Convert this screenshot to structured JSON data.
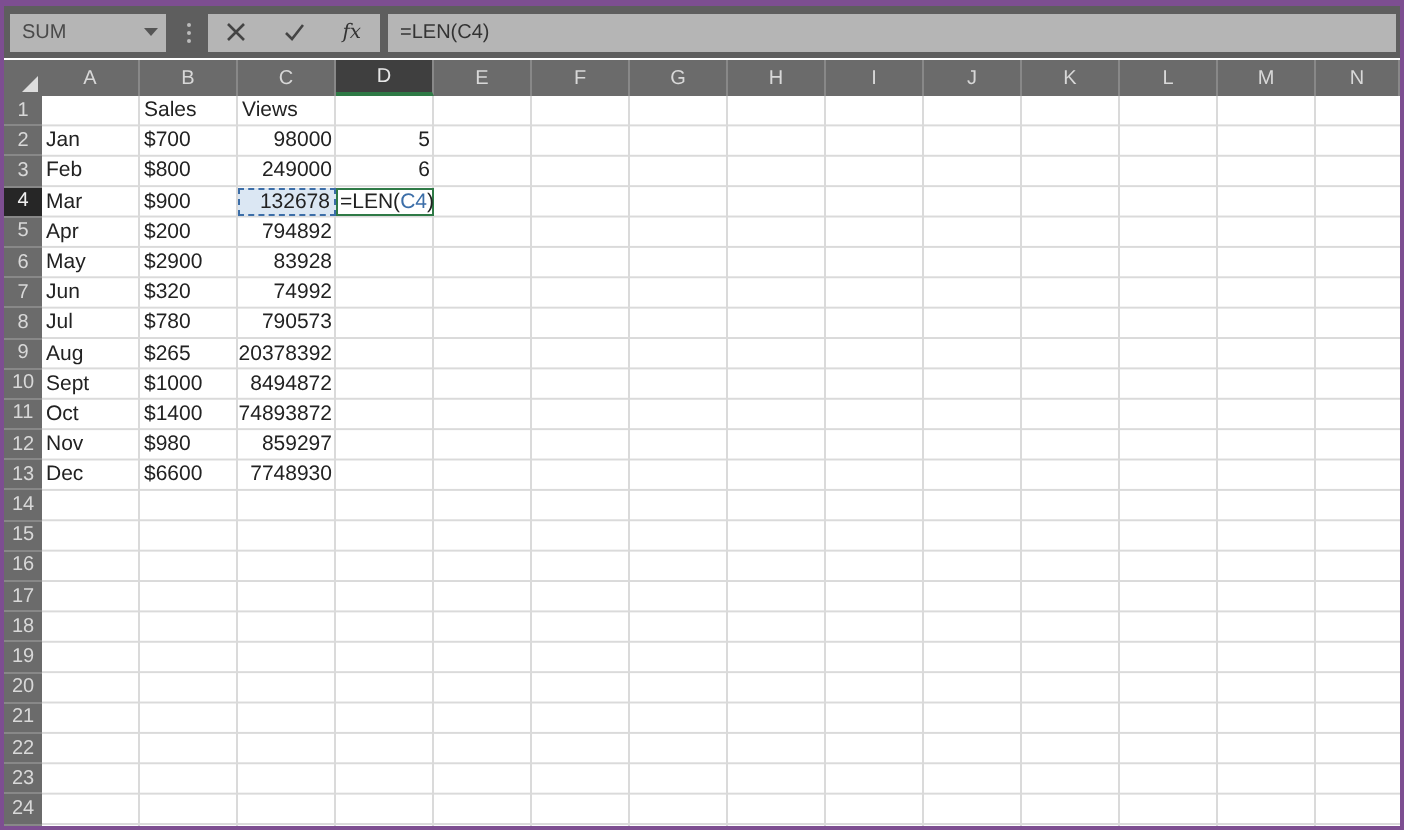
{
  "name_box": {
    "value": "SUM"
  },
  "formula_bar": {
    "buttons": [
      "fx"
    ],
    "formula": "=LEN(C4)"
  },
  "columns": [
    {
      "label": "A",
      "selected": false
    },
    {
      "label": "B",
      "selected": false
    },
    {
      "label": "C",
      "selected": false
    },
    {
      "label": "D",
      "selected": true
    },
    {
      "label": "E",
      "selected": false
    },
    {
      "label": "F",
      "selected": false
    },
    {
      "label": "G",
      "selected": false
    },
    {
      "label": "H",
      "selected": false
    },
    {
      "label": "I",
      "selected": false
    },
    {
      "label": "J",
      "selected": false
    },
    {
      "label": "K",
      "selected": false
    },
    {
      "label": "L",
      "selected": false
    },
    {
      "label": "M",
      "selected": false
    },
    {
      "label": "N",
      "selected": false
    }
  ],
  "rows": [
    {
      "label": "1",
      "selected": false,
      "cells": [
        null,
        {
          "text": "Sales",
          "kind": "text"
        },
        {
          "text": "Views",
          "kind": "text"
        },
        null
      ]
    },
    {
      "label": "2",
      "selected": false,
      "cells": [
        {
          "text": "Jan",
          "kind": "text"
        },
        {
          "text": "$700",
          "kind": "text"
        },
        {
          "text": "98000",
          "kind": "number"
        },
        {
          "text": "5",
          "kind": "number"
        }
      ]
    },
    {
      "label": "3",
      "selected": false,
      "cells": [
        {
          "text": "Feb",
          "kind": "text"
        },
        {
          "text": "$800",
          "kind": "text"
        },
        {
          "text": "249000",
          "kind": "number"
        },
        {
          "text": "6",
          "kind": "number"
        }
      ]
    },
    {
      "label": "4",
      "selected": true,
      "cells": [
        {
          "text": "Mar",
          "kind": "text"
        },
        {
          "text": "$900",
          "kind": "text"
        },
        {
          "text": "132678",
          "kind": "referenced"
        },
        {
          "kind": "editing",
          "parts": [
            {
              "text": "=LEN(",
              "kind": "plain"
            },
            {
              "text": "C4",
              "kind": "reference"
            },
            {
              "text": ")",
              "kind": "plain"
            }
          ]
        }
      ]
    },
    {
      "label": "5",
      "selected": false,
      "cells": [
        {
          "text": "Apr",
          "kind": "text"
        },
        {
          "text": "$200",
          "kind": "text"
        },
        {
          "text": "794892",
          "kind": "number"
        },
        null
      ]
    },
    {
      "label": "6",
      "selected": false,
      "cells": [
        {
          "text": "May",
          "kind": "text"
        },
        {
          "text": "$2900",
          "kind": "text"
        },
        {
          "text": "83928",
          "kind": "number"
        },
        null
      ]
    },
    {
      "label": "7",
      "selected": false,
      "cells": [
        {
          "text": "Jun",
          "kind": "text"
        },
        {
          "text": "$320",
          "kind": "text"
        },
        {
          "text": "74992",
          "kind": "number"
        },
        null
      ]
    },
    {
      "label": "8",
      "selected": false,
      "cells": [
        {
          "text": "Jul",
          "kind": "text"
        },
        {
          "text": "$780",
          "kind": "text"
        },
        {
          "text": "790573",
          "kind": "number"
        },
        null
      ]
    },
    {
      "label": "9",
      "selected": false,
      "cells": [
        {
          "text": "Aug",
          "kind": "text"
        },
        {
          "text": "$265",
          "kind": "text"
        },
        {
          "text": "20378392",
          "kind": "number"
        },
        null
      ]
    },
    {
      "label": "10",
      "selected": false,
      "cells": [
        {
          "text": "Sept",
          "kind": "text"
        },
        {
          "text": "$1000",
          "kind": "text"
        },
        {
          "text": "8494872",
          "kind": "number"
        },
        null
      ]
    },
    {
      "label": "11",
      "selected": false,
      "cells": [
        {
          "text": "Oct",
          "kind": "text"
        },
        {
          "text": "$1400",
          "kind": "text"
        },
        {
          "text": "74893872",
          "kind": "number"
        },
        null
      ]
    },
    {
      "label": "12",
      "selected": false,
      "cells": [
        {
          "text": "Nov",
          "kind": "text"
        },
        {
          "text": "$980",
          "kind": "text"
        },
        {
          "text": "859297",
          "kind": "number"
        },
        null
      ]
    },
    {
      "label": "13",
      "selected": false,
      "cells": [
        {
          "text": "Dec",
          "kind": "text"
        },
        {
          "text": "$6600",
          "kind": "text"
        },
        {
          "text": "7748930",
          "kind": "number"
        },
        null
      ]
    },
    {
      "label": "14",
      "selected": false,
      "cells": []
    },
    {
      "label": "15",
      "selected": false,
      "cells": []
    },
    {
      "label": "16",
      "selected": false,
      "cells": []
    },
    {
      "label": "17",
      "selected": false,
      "cells": []
    },
    {
      "label": "18",
      "selected": false,
      "cells": []
    },
    {
      "label": "19",
      "selected": false,
      "cells": []
    },
    {
      "label": "20",
      "selected": false,
      "cells": []
    },
    {
      "label": "21",
      "selected": false,
      "cells": []
    },
    {
      "label": "22",
      "selected": false,
      "cells": []
    },
    {
      "label": "23",
      "selected": false,
      "cells": []
    },
    {
      "label": "24",
      "selected": false,
      "cells": []
    }
  ]
}
